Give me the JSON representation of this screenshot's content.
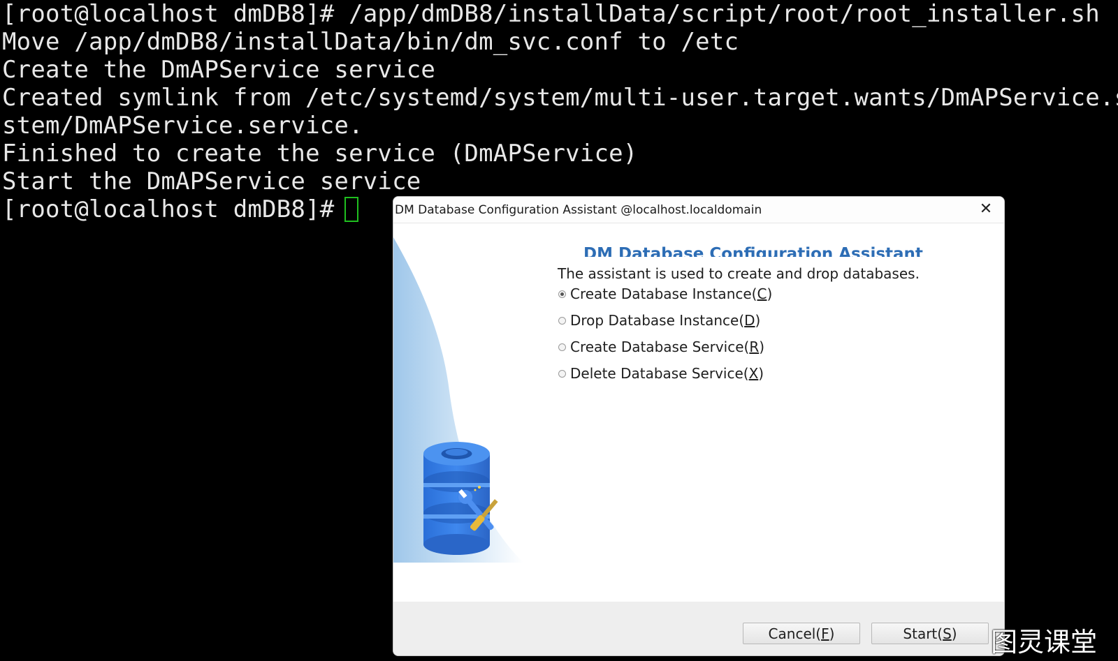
{
  "terminal": {
    "lines": [
      "[root@localhost dmDB8]# /app/dmDB8/installData/script/root/root_installer.sh",
      "Move /app/dmDB8/installData/bin/dm_svc.conf to /etc",
      "Create the DmAPService service",
      "Created symlink from /etc/systemd/system/multi-user.target.wants/DmAPService.s",
      "stem/DmAPService.service.",
      "Finished to create the service (DmAPService)",
      "Start the DmAPService service",
      "[root@localhost dmDB8]# "
    ],
    "cursor_color": "#1fbf1f",
    "text_color": "#e8e8e8",
    "background": "#000000"
  },
  "dialog": {
    "title": "DM Database Configuration Assistant @localhost.localdomain",
    "close_label": "✕",
    "header_title": "DM Database Configuration Assistant",
    "description": "The assistant is used to create and drop databases.",
    "options": [
      {
        "label": "Create Database Instance(",
        "mnemonic": "C",
        "suffix": ")",
        "selected": true
      },
      {
        "label": "Drop Database Instance(",
        "mnemonic": "D",
        "suffix": ")",
        "selected": false
      },
      {
        "label": "Create Database Service(",
        "mnemonic": "R",
        "suffix": ")",
        "selected": false
      },
      {
        "label": "Delete Database Service(",
        "mnemonic": "X",
        "suffix": ")",
        "selected": false
      }
    ],
    "buttons": {
      "cancel": {
        "label": "Cancel(",
        "mnemonic": "F",
        "suffix": ")"
      },
      "start": {
        "label": "Start(",
        "mnemonic": "S",
        "suffix": ")"
      }
    },
    "accent_color": "#2d6db5",
    "illustration_icon": "database-wrench-icon"
  },
  "watermark": "图灵课堂"
}
